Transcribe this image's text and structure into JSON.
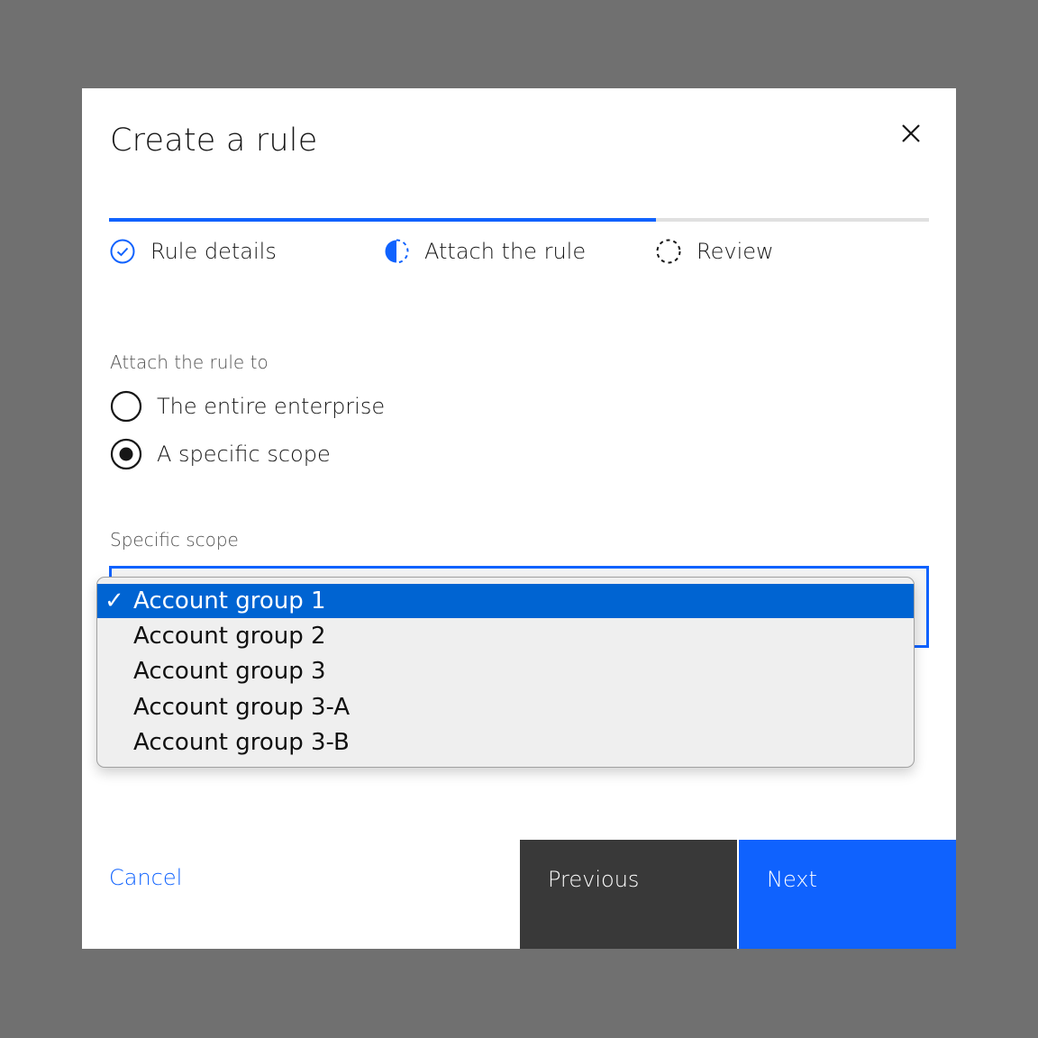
{
  "modal": {
    "title": "Create a rule",
    "close_icon": "close-icon"
  },
  "progress": {
    "completed_fraction": 0.667,
    "colors": {
      "active": "#0f62fe",
      "track": "#e0e0e0"
    },
    "steps": [
      {
        "label": "Rule details",
        "state": "complete",
        "icon": "checkmark-outline-icon"
      },
      {
        "label": "Attach the rule",
        "state": "current",
        "icon": "incomplete-half-icon"
      },
      {
        "label": "Review",
        "state": "not-started",
        "icon": "circle-dash-icon"
      }
    ]
  },
  "form": {
    "attach_label": "Attach the rule to",
    "radios": [
      {
        "label": "The entire enterprise",
        "checked": false
      },
      {
        "label": "A specific scope",
        "checked": true
      }
    ],
    "scope_label": "Specific scope",
    "scope_select": {
      "selected": "Account group 1",
      "options": [
        {
          "label": "Account group 1",
          "selected": true
        },
        {
          "label": "Account group 2",
          "selected": false
        },
        {
          "label": "Account group 3",
          "selected": false
        },
        {
          "label": "Account group 3-A",
          "selected": false
        },
        {
          "label": "Account group 3-B",
          "selected": false
        }
      ],
      "check_glyph": "✓"
    }
  },
  "footer": {
    "cancel_label": "Cancel",
    "previous_label": "Previous",
    "next_label": "Next"
  },
  "colors": {
    "primary": "#0f62fe",
    "secondary_button": "#393939",
    "overlay": "#707070",
    "menu_highlight": "#0064d2"
  }
}
